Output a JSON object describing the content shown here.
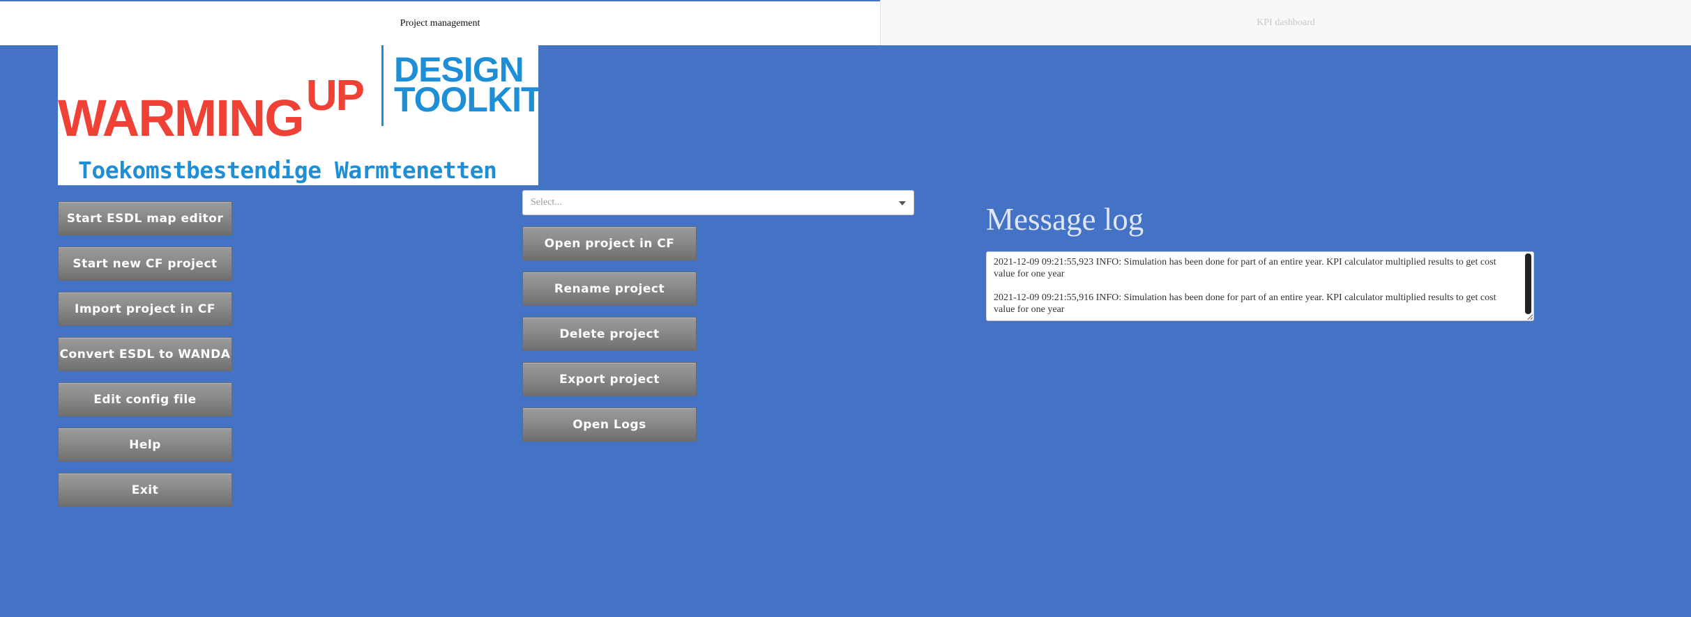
{
  "tabs": [
    {
      "label": "Project management",
      "active": true
    },
    {
      "label": "KPI dashboard",
      "active": false
    }
  ],
  "logo": {
    "warming": "WARMING",
    "up": "UP",
    "design_line1": "DESIGN",
    "design_line2": "TOOLKIT",
    "tagline": "Toekomstbestendige Warmtenetten"
  },
  "left_buttons": [
    "Start ESDL map editor",
    "Start new CF project",
    "Import project in CF",
    "Convert ESDL to WANDA",
    "Edit config file",
    "Help",
    "Exit"
  ],
  "project_select": {
    "placeholder": "Select..."
  },
  "middle_buttons": [
    "Open project in CF",
    "Rename project",
    "Delete project",
    "Export project",
    "Open Logs"
  ],
  "message_log": {
    "title": "Message log",
    "entries": [
      "2021-12-09 09:21:55,923 INFO: Simulation has been done for part of an entire year. KPI calculator multiplied results to get cost value for one year",
      "2021-12-09 09:21:55,916 INFO: Simulation has been done for part of an entire year. KPI calculator multiplied results to get cost value for one year"
    ]
  },
  "colors": {
    "background": "#4472c4",
    "logo_red": "#ef4136",
    "logo_blue": "#1e8fd6",
    "button_gray": "#8a8a8a"
  }
}
